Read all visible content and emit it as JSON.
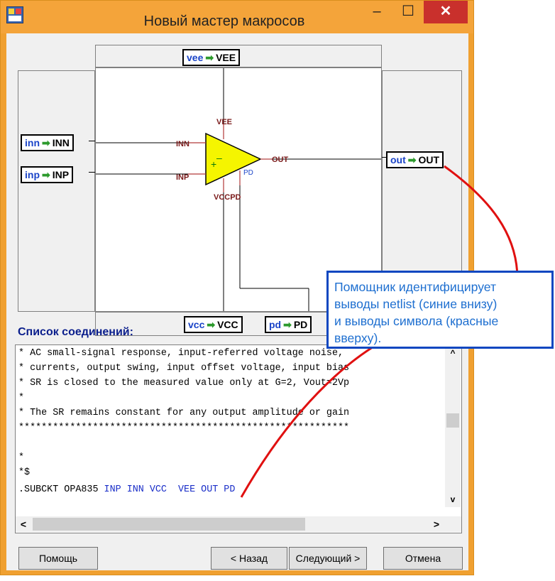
{
  "window": {
    "title": "Новый мастер макросов",
    "minimize_glyph": "–",
    "maximize_glyph": "☐",
    "close_glyph": "✕"
  },
  "schematic": {
    "arrow": "➡",
    "top_pins": [
      {
        "net": "vee",
        "pin": "VEE"
      }
    ],
    "left_pins": [
      {
        "net": "inn",
        "pin": "INN"
      },
      {
        "net": "inp",
        "pin": "INP"
      }
    ],
    "right_pins": [
      {
        "net": "out",
        "pin": "OUT"
      }
    ],
    "bottom_pins": [
      {
        "net": "vcc",
        "pin": "VCC"
      },
      {
        "net": "pd",
        "pin": "PD"
      }
    ],
    "symbol_labels": {
      "vee": "VEE",
      "inn": "INN",
      "inp": "INP",
      "out": "OUT",
      "vcc_pd": "VCCPD",
      "pd": "PD",
      "minus": "–",
      "plus": "+"
    }
  },
  "netlist": {
    "title": "Список соединений:",
    "lines": [
      "* AC small-signal response, input-referred voltage noise,",
      "* currents, output swing, input offset voltage, input bias",
      "* SR is closed to the measured value only at G=2, Vout=2Vp",
      "*",
      "* The SR remains constant for any output amplitude or gain",
      "**********************************************************",
      "",
      "*",
      "*$"
    ],
    "subckt_prefix": ".SUBCKT OPA835 ",
    "subckt_pins": "INP INN VCC  VEE OUT PD",
    "scroll": {
      "up": "^",
      "down": "v",
      "left": "<",
      "right": ">"
    }
  },
  "buttons": {
    "help": "Помощь",
    "back": "< Назад",
    "next": "Следующий >",
    "cancel": "Отмена"
  },
  "callout": {
    "lines": [
      "Помощник идентифицирует",
      "выводы netlist (синие внизу)",
      "и выводы символа (красные",
      "вверху)."
    ]
  },
  "colors": {
    "titlebar": "#f4a43a",
    "close": "#c9302c",
    "net_name": "#1a44c8",
    "arrow": "#2c9a2c",
    "opamp_fill": "#f5f500",
    "callout_border": "#0d47c0",
    "callout_text": "#1e6fd0",
    "annotation_line": "#e01010"
  }
}
